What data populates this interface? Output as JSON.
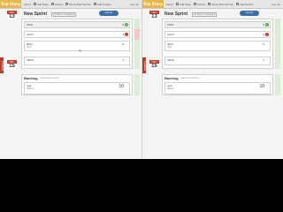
{
  "app": {
    "logo": "Trip Story",
    "topbar_right": "Log out"
  },
  "tabs": [
    "Sprint",
    "Add Story",
    "Stories",
    "Show Past Sprints",
    "Add People"
  ],
  "date": {
    "month": "DEC",
    "day": "13"
  },
  "sprint": {
    "title": "New Sprint",
    "meta": "29 Task or completed",
    "badge": "Velocity"
  },
  "rows": [
    {
      "title": "Infinit",
      "sub": "",
      "count": "5",
      "action": "check"
    },
    {
      "title": "unfort",
      "sub": "",
      "count": "3",
      "action": "minus"
    },
    {
      "title": "fjrhjh",
      "sub": "fjrhjh",
      "count": "5",
      "action": "more"
    },
    {
      "title": "fnfbns",
      "sub": "",
      "count": "1",
      "action": "more"
    }
  ],
  "date2": {
    "month": "DEC",
    "day": "15"
  },
  "edge_flag": "Feedback",
  "backlog": {
    "title": "Backlog",
    "meta": "stories not in sprint",
    "row_title": "cyer",
    "row_sub": "fddfsdf",
    "count": "10"
  },
  "colors": {
    "accent": "#e8b64a",
    "date_red": "#c0392b",
    "badge_blue": "#3b6ea5",
    "ok_green": "#4caf50"
  },
  "icons": {
    "check": "check-icon",
    "minus": "minus-icon",
    "more": "more-icon"
  }
}
